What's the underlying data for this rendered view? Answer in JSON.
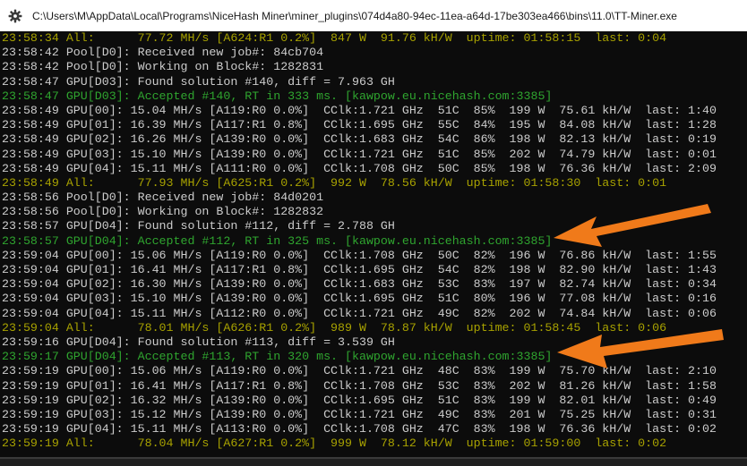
{
  "window": {
    "title": "C:\\Users\\M\\AppData\\Local\\Programs\\NiceHash Miner\\miner_plugins\\074d4a80-94ec-11ea-a64d-17be303ea466\\bins\\11.0\\TT-Miner.exe",
    "icon": "gear-icon"
  },
  "colors": {
    "summary": "#a8a200",
    "accepted": "#2fa52f",
    "normal": "#cccccc",
    "arrow": "#f07a1a",
    "background": "#0c0c0c"
  },
  "annotations": {
    "arrow_color": "#f07a1a",
    "arrow_count": 2
  },
  "console": {
    "lines": [
      {
        "type": "summary",
        "text": "23:58:34 All:      77.72 MH/s [A624:R1 0.2%]  847 W  91.76 kH/W  uptime: 01:58:15  last: 0:04"
      },
      {
        "type": "normal",
        "text": "23:58:42 Pool[D0]: Received new job#: 84cb704"
      },
      {
        "type": "normal",
        "text": "23:58:42 Pool[D0]: Working on Block#: 1282831"
      },
      {
        "type": "normal",
        "text": "23:58:47 GPU[D03]: Found solution #140, diff = 7.963 GH"
      },
      {
        "type": "accepted",
        "text": "23:58:47 GPU[D03]: Accepted #140, RT in 333 ms. [kawpow.eu.nicehash.com:3385]"
      },
      {
        "type": "normal",
        "text": "23:58:49 GPU[00]: 15.04 MH/s [A119:R0 0.0%]  CClk:1.721 GHz  51C  85%  199 W  75.61 kH/W  last: 1:40"
      },
      {
        "type": "normal",
        "text": "23:58:49 GPU[01]: 16.39 MH/s [A117:R1 0.8%]  CClk:1.695 GHz  55C  84%  195 W  84.08 kH/W  last: 1:28"
      },
      {
        "type": "normal",
        "text": "23:58:49 GPU[02]: 16.26 MH/s [A139:R0 0.0%]  CClk:1.683 GHz  54C  86%  198 W  82.13 kH/W  last: 0:19"
      },
      {
        "type": "normal",
        "text": "23:58:49 GPU[03]: 15.10 MH/s [A139:R0 0.0%]  CClk:1.721 GHz  51C  85%  202 W  74.79 kH/W  last: 0:01"
      },
      {
        "type": "normal",
        "text": "23:58:49 GPU[04]: 15.11 MH/s [A111:R0 0.0%]  CClk:1.708 GHz  50C  85%  198 W  76.36 kH/W  last: 2:09"
      },
      {
        "type": "summary",
        "text": "23:58:49 All:      77.93 MH/s [A625:R1 0.2%]  992 W  78.56 kH/W  uptime: 01:58:30  last: 0:01"
      },
      {
        "type": "normal",
        "text": "23:58:56 Pool[D0]: Received new job#: 84d0201"
      },
      {
        "type": "normal",
        "text": "23:58:56 Pool[D0]: Working on Block#: 1282832"
      },
      {
        "type": "normal",
        "text": "23:58:57 GPU[D04]: Found solution #112, diff = 2.788 GH"
      },
      {
        "type": "accepted",
        "text": "23:58:57 GPU[D04]: Accepted #112, RT in 325 ms. [kawpow.eu.nicehash.com:3385]"
      },
      {
        "type": "normal",
        "text": "23:59:04 GPU[00]: 15.06 MH/s [A119:R0 0.0%]  CClk:1.708 GHz  50C  82%  196 W  76.86 kH/W  last: 1:55"
      },
      {
        "type": "normal",
        "text": "23:59:04 GPU[01]: 16.41 MH/s [A117:R1 0.8%]  CClk:1.695 GHz  54C  82%  198 W  82.90 kH/W  last: 1:43"
      },
      {
        "type": "normal",
        "text": "23:59:04 GPU[02]: 16.30 MH/s [A139:R0 0.0%]  CClk:1.683 GHz  53C  83%  197 W  82.74 kH/W  last: 0:34"
      },
      {
        "type": "normal",
        "text": "23:59:04 GPU[03]: 15.10 MH/s [A139:R0 0.0%]  CClk:1.695 GHz  51C  80%  196 W  77.08 kH/W  last: 0:16"
      },
      {
        "type": "normal",
        "text": "23:59:04 GPU[04]: 15.11 MH/s [A112:R0 0.0%]  CClk:1.721 GHz  49C  82%  202 W  74.84 kH/W  last: 0:06"
      },
      {
        "type": "summary",
        "text": "23:59:04 All:      78.01 MH/s [A626:R1 0.2%]  989 W  78.87 kH/W  uptime: 01:58:45  last: 0:06"
      },
      {
        "type": "normal",
        "text": "23:59:16 GPU[D04]: Found solution #113, diff = 3.539 GH"
      },
      {
        "type": "accepted",
        "text": "23:59:17 GPU[D04]: Accepted #113, RT in 320 ms. [kawpow.eu.nicehash.com:3385]"
      },
      {
        "type": "normal",
        "text": "23:59:19 GPU[00]: 15.06 MH/s [A119:R0 0.0%]  CClk:1.721 GHz  48C  83%  199 W  75.70 kH/W  last: 2:10"
      },
      {
        "type": "normal",
        "text": "23:59:19 GPU[01]: 16.41 MH/s [A117:R1 0.8%]  CClk:1.708 GHz  53C  83%  202 W  81.26 kH/W  last: 1:58"
      },
      {
        "type": "normal",
        "text": "23:59:19 GPU[02]: 16.32 MH/s [A139:R0 0.0%]  CClk:1.695 GHz  51C  83%  199 W  82.01 kH/W  last: 0:49"
      },
      {
        "type": "normal",
        "text": "23:59:19 GPU[03]: 15.12 MH/s [A139:R0 0.0%]  CClk:1.721 GHz  49C  83%  201 W  75.25 kH/W  last: 0:31"
      },
      {
        "type": "normal",
        "text": "23:59:19 GPU[04]: 15.11 MH/s [A113:R0 0.0%]  CClk:1.708 GHz  47C  83%  198 W  76.36 kH/W  last: 0:02"
      },
      {
        "type": "summary",
        "text": "23:59:19 All:      78.04 MH/s [A627:R1 0.2%]  999 W  78.12 kH/W  uptime: 01:59:00  last: 0:02"
      }
    ]
  }
}
